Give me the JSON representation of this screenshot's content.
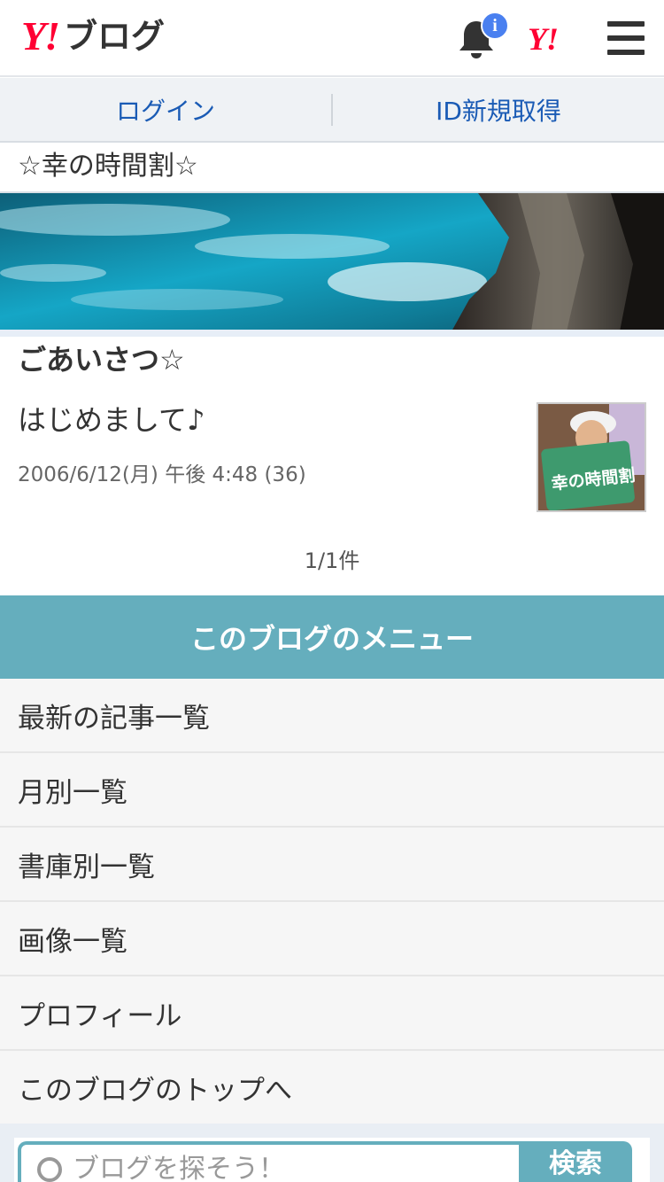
{
  "header": {
    "logo_mark": "Y!",
    "logo_text": "ブログ",
    "notification_badge": "i",
    "yahoo_link": "Y!",
    "colors": {
      "brand_red": "#ff0033",
      "badge_blue": "#4a80f0"
    },
    "icons": [
      "bell-icon",
      "menu-icon"
    ]
  },
  "auth": {
    "login_label": "ログイン",
    "signup_label": "ID新規取得",
    "link_color": "#1a5bb5"
  },
  "blog": {
    "title": "☆幸の時間割☆"
  },
  "article_section": {
    "heading": "ごあいさつ☆",
    "article": {
      "title": "はじめまして♪",
      "meta": "2006/6/12(月) 午後 4:48 (36)",
      "thumbnail_text": "幸の時間割"
    },
    "pager": "1/1件"
  },
  "menu": {
    "header": "このブログのメニュー",
    "header_color": "#65aebd",
    "items": [
      {
        "label": "最新の記事一覧"
      },
      {
        "label": "月別一覧"
      },
      {
        "label": "書庫別一覧"
      },
      {
        "label": "画像一覧"
      },
      {
        "label": "プロフィール"
      },
      {
        "label": "このブログのトップへ"
      }
    ]
  },
  "search": {
    "placeholder": "ブログを探そう！",
    "button_label": "検索"
  }
}
